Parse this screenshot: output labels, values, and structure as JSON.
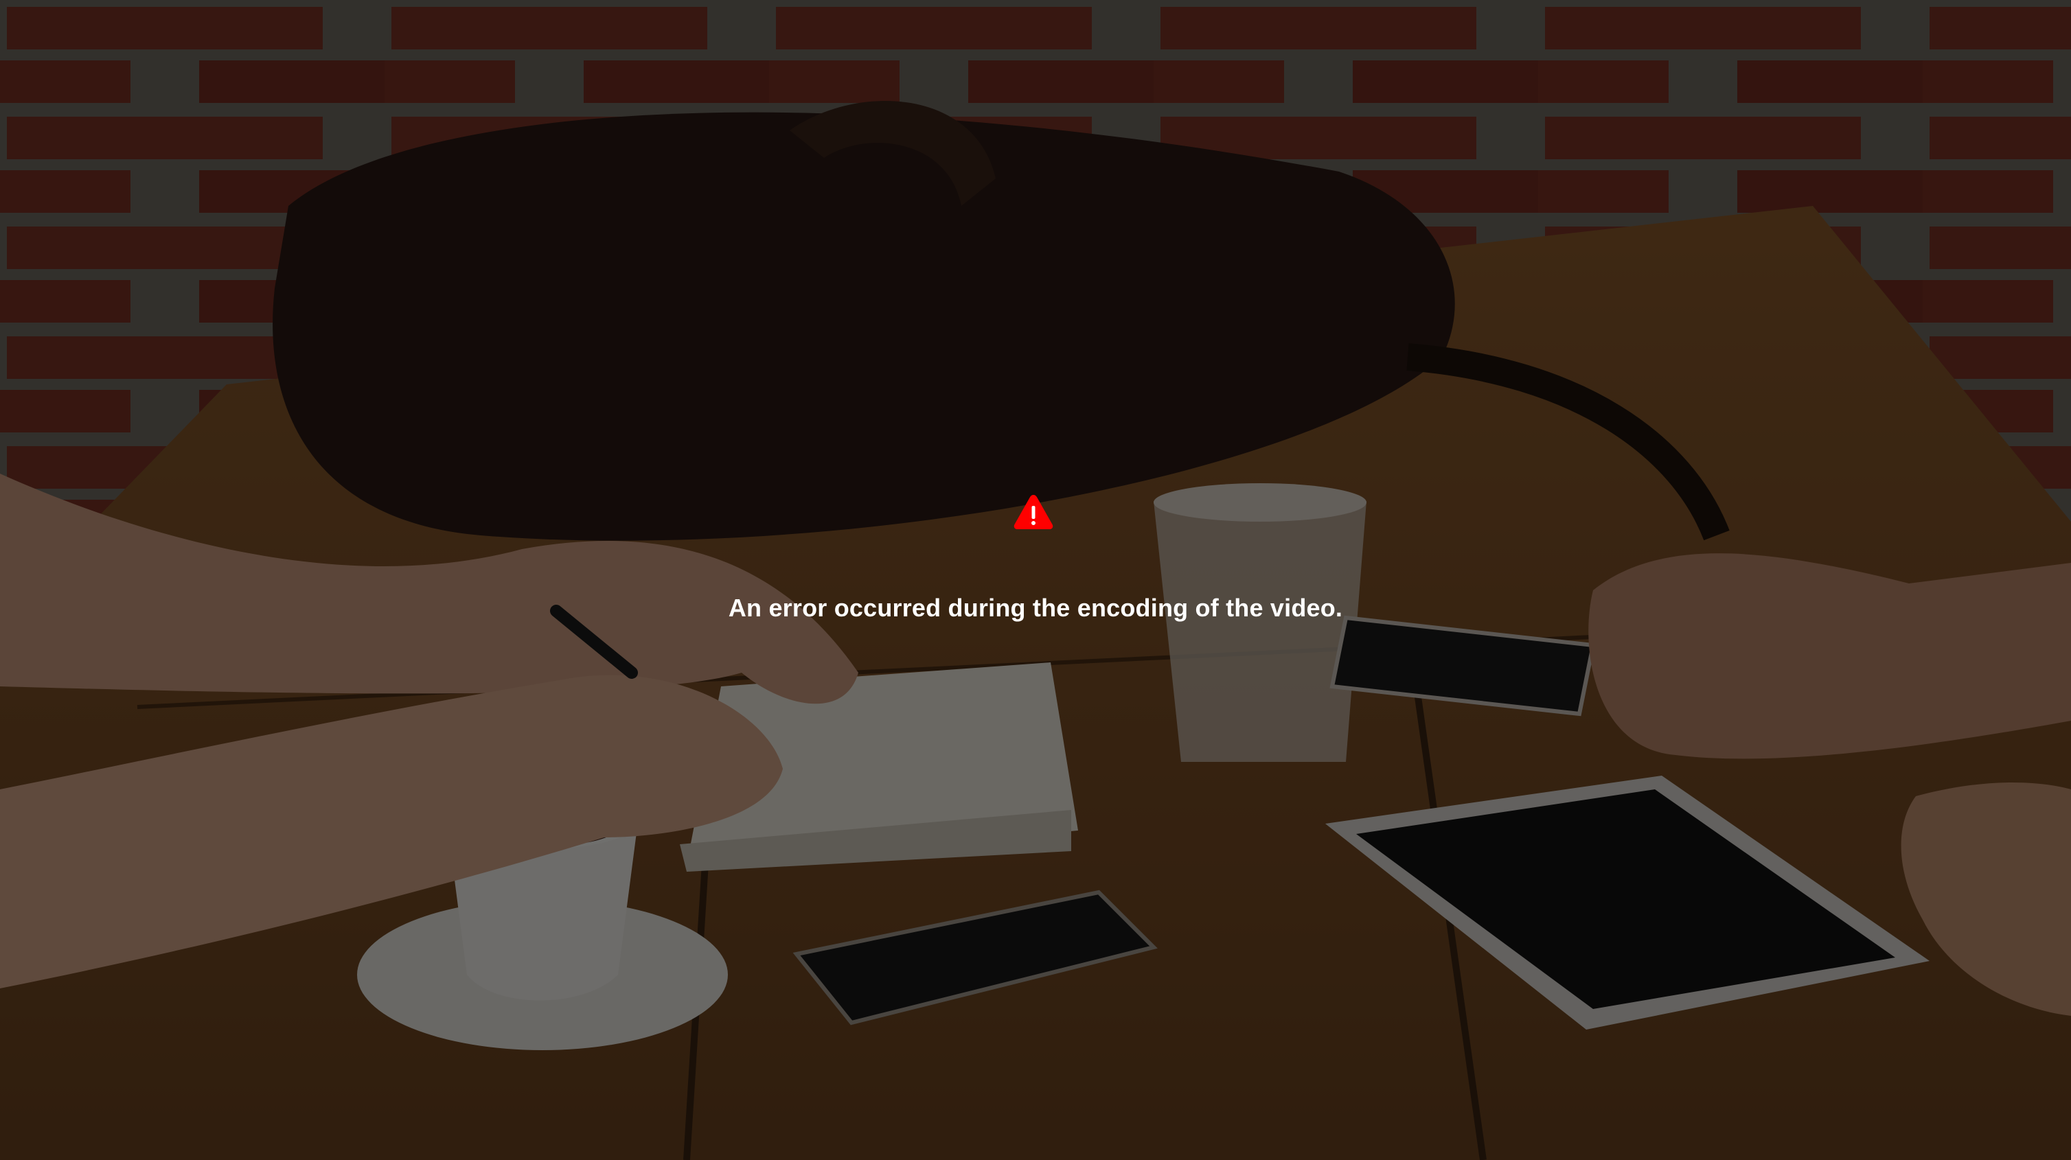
{
  "player": {
    "poster_icon": "coffee-table-photo",
    "error": {
      "icon": "warning-triangle-icon",
      "icon_color": "#ff0000",
      "message": "An error occurred during the encoding of the video."
    }
  }
}
